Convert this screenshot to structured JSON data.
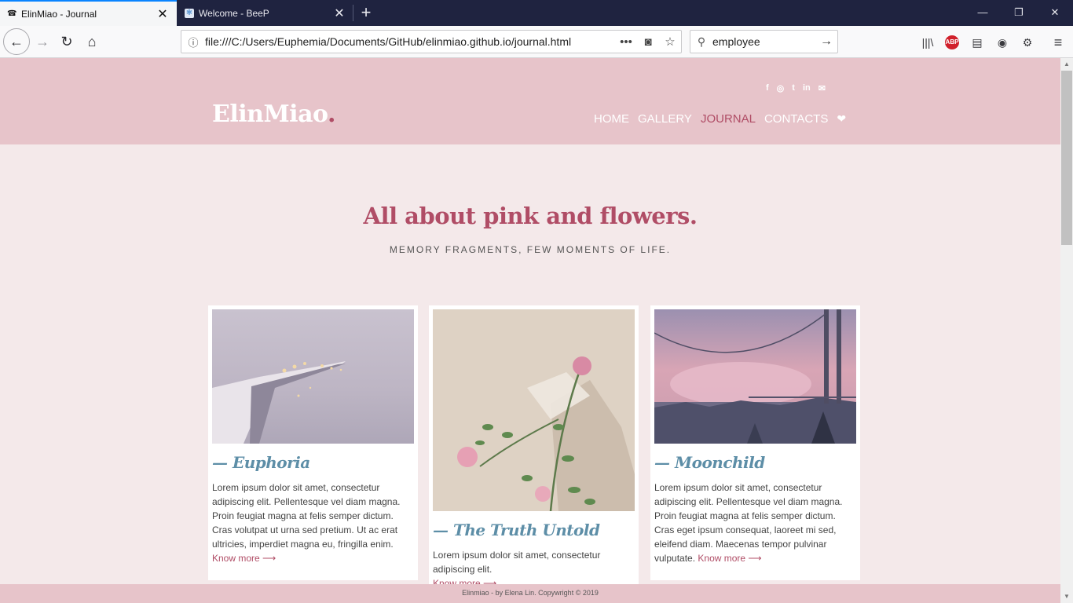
{
  "browser": {
    "tabs": [
      {
        "title": "ElinMiao - Journal",
        "close": "✕"
      },
      {
        "title": "Welcome - BeeP",
        "close": "✕"
      }
    ],
    "new_tab": "+",
    "window_controls": {
      "minimize": "—",
      "restore": "❐",
      "close": "✕"
    },
    "nav": {
      "back": "←",
      "forward": "→",
      "reload": "↻",
      "home": "⌂"
    },
    "url": "file:///C:/Users/Euphemia/Documents/GitHub/elinmiao.github.io/journal.html",
    "url_info": "ⓘ",
    "page_actions": {
      "more": "•••",
      "pocket": "◙",
      "bookmark": "☆"
    },
    "search": {
      "value": "employee",
      "go": "→"
    },
    "tools": {
      "library": "|||\\",
      "abp": "ABP",
      "reader": "▤",
      "account": "◉",
      "settings": "⚙",
      "menu": "≡"
    },
    "accent_color": "#0a84ff"
  },
  "site": {
    "logo": "ElinMiao",
    "logo_dot": ".",
    "social_icons": [
      {
        "glyph": "f",
        "icon": "facebook-icon"
      },
      {
        "glyph": "◎",
        "icon": "instagram-icon"
      },
      {
        "glyph": "t",
        "icon": "twitter-icon"
      },
      {
        "glyph": "in",
        "icon": "linkedin-icon"
      },
      {
        "glyph": "✉",
        "icon": "wechat-icon"
      }
    ],
    "nav": [
      "HOME",
      "GALLERY",
      "JOURNAL",
      "CONTACTS"
    ],
    "nav_active": "JOURNAL",
    "heart": "❤",
    "brand_color": "#b04d66",
    "header_color": "#e7c4ca"
  },
  "hero": {
    "title": "All about pink and flowers.",
    "subtitle": "MEMORY FRAGMENTS, FEW MOMENTS OF LIFE."
  },
  "cards": [
    {
      "title": "— Euphoria",
      "text": "Lorem ipsum dolor sit amet, consectetur adipiscing elit. Pellentesque vel diam magna. Proin feugiat magna at felis semper dictum. Cras volutpat ut urna sed pretium. Ut ac erat ultricies, imperdiet magna eu, fringilla enim.",
      "more": "Know more ⟶"
    },
    {
      "title": "— The Truth Untold",
      "text": "Lorem ipsum dolor sit amet, consectetur adipiscing elit.",
      "more": "Know more ⟶"
    },
    {
      "title": "— Moonchild",
      "text": "Lorem ipsum dolor sit amet, consectetur adipiscing elit. Pellentesque vel diam magna. Proin feugiat magna at felis semper dictum. Cras eget ipsum consequat, laoreet mi sed, eleifend diam. Maecenas tempor pulvinar vulputate.",
      "more": "Know more ⟶"
    }
  ],
  "footer": "Elinmiao - by Elena Lin. Copywright © 2019"
}
